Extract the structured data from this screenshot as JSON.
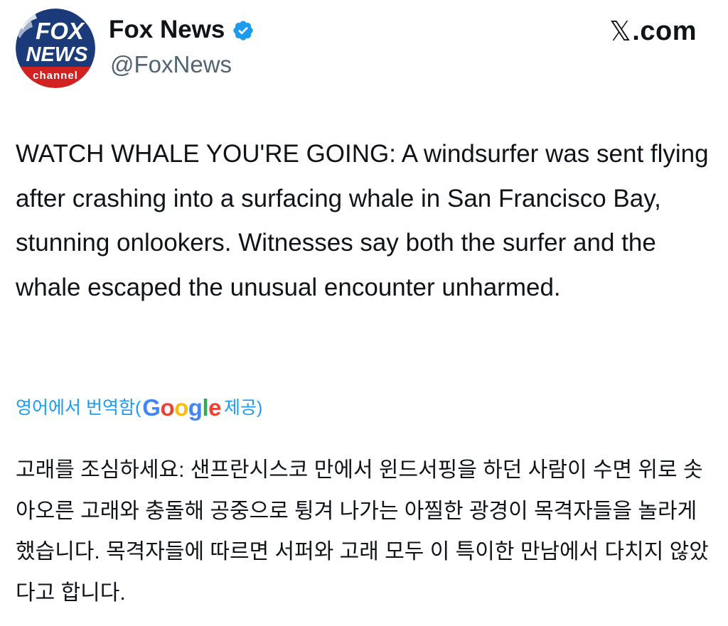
{
  "author": {
    "name": "Fox News",
    "handle": "@FoxNews",
    "verified": true,
    "verified_icon": "verified-badge-icon",
    "avatar": {
      "logo_line1": "FOX",
      "logo_line2": "NEWS",
      "logo_line3": "channel",
      "colors": {
        "blue": "#1a3a7a",
        "red": "#d12121",
        "white": "#ffffff"
      }
    }
  },
  "site": {
    "x_logo": "𝕏",
    "domain_suffix": ".com"
  },
  "tweet": {
    "text": "WATCH WHALE YOU'RE GOING: A windsurfer was sent flying after crashing into a surfacing whale in San Francisco Bay, stunning onlookers. Witnesses say both the surfer and the whale escaped the unusual encounter unharmed."
  },
  "translation": {
    "label_prefix": "영어에서 번역함(",
    "provider": "Google",
    "label_suffix": "제공)",
    "text": "고래를 조심하세요: 샌프란시스코 만에서 윈드서핑을 하던 사람이 수면 위로 솟아오른 고래와 충돌해 공중으로 튕겨 나가는 아찔한 광경이 목격자들을 놀라게 했습니다. 목격자들에 따르면 서퍼와 고래 모두 이 특이한 만남에서 다치지 않았다고 합니다."
  },
  "colors": {
    "text": "#0f1419",
    "secondary_text": "#536471",
    "link_blue": "#1d9bf0",
    "verified_blue": "#1d9bf0",
    "google_blue": "#4285F4",
    "google_red": "#EA4335",
    "google_yellow": "#FBBC05",
    "google_green": "#34A853"
  }
}
